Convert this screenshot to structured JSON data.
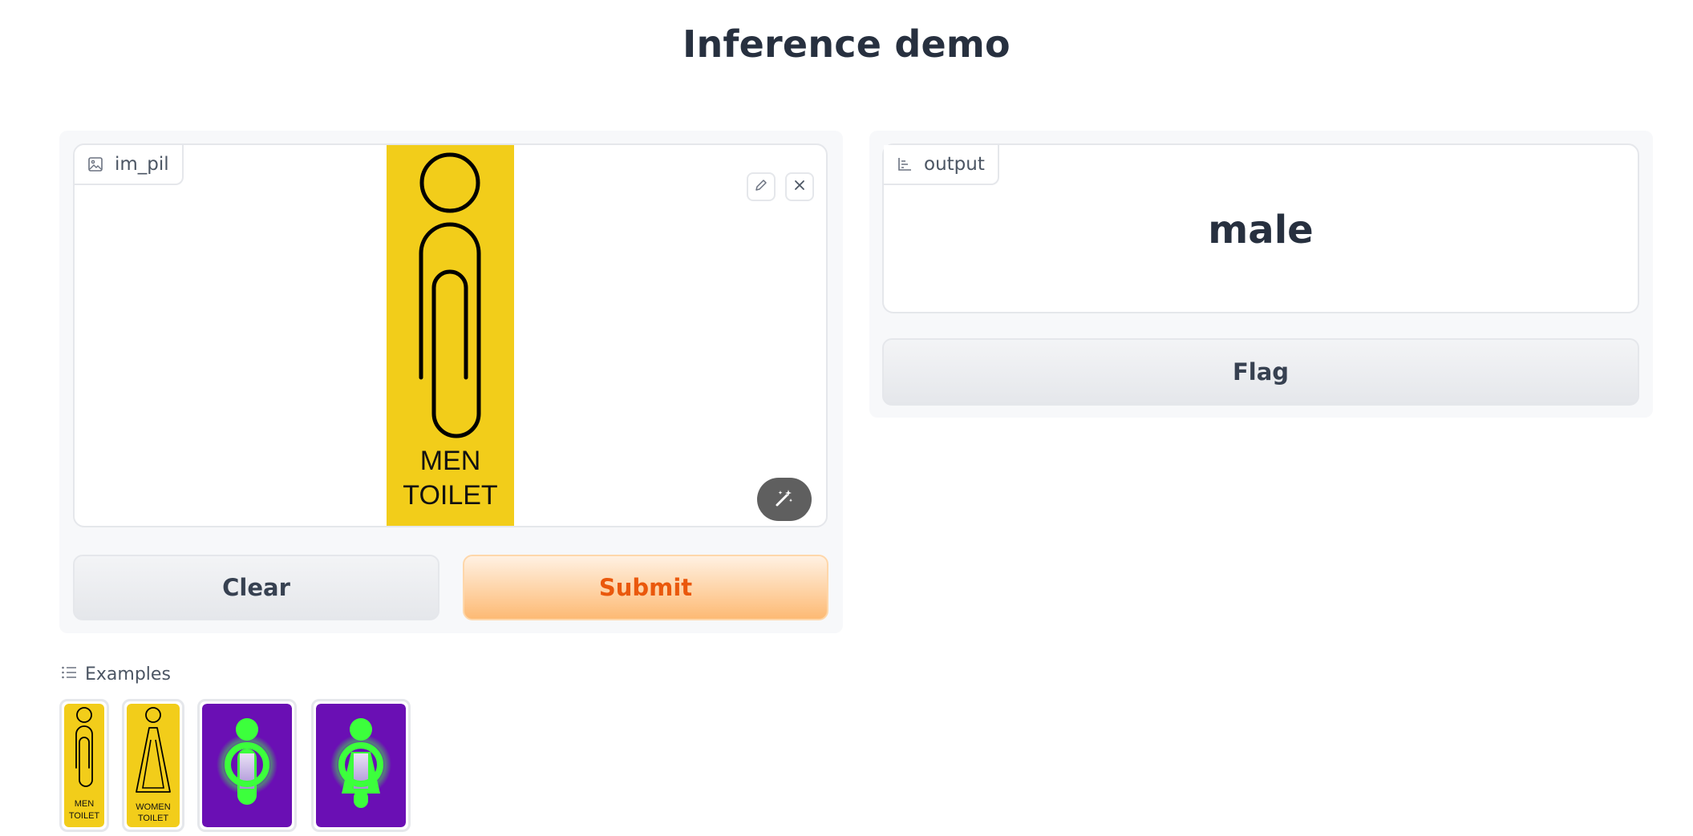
{
  "page": {
    "title": "Inference demo"
  },
  "input": {
    "label": "im_pil",
    "label_icon": "image-icon",
    "preview_text_line1": "MEN",
    "preview_text_line2": "TOILET",
    "preview_bg_color": "#f2cd1a",
    "edit_icon": "pencil-icon",
    "close_icon": "close-icon",
    "magic_icon": "magic-wand-icon"
  },
  "actions": {
    "clear_label": "Clear",
    "submit_label": "Submit"
  },
  "output": {
    "label": "output",
    "label_icon": "bar-chart-icon",
    "value": "male",
    "flag_label": "Flag"
  },
  "examples": {
    "heading": "Examples",
    "heading_icon": "list-icon",
    "items": [
      {
        "line1": "MEN",
        "line2": "TOILET",
        "bg": "#f2cd1a"
      },
      {
        "line1": "WOMEN",
        "line2": "TOILET",
        "bg": "#f2cd1a"
      },
      {
        "symbol": "male-glow-figure",
        "bg": "#6a0fb4",
        "figure_color": "#3cff3c"
      },
      {
        "symbol": "female-glow-figure",
        "bg": "#6a0fb4",
        "figure_color": "#3cff3c"
      }
    ]
  },
  "colors": {
    "accent": "#ea580c",
    "submit_gradient_end": "#fdba74",
    "panel_bg": "#f7f8fa",
    "border": "#e5e7eb"
  }
}
